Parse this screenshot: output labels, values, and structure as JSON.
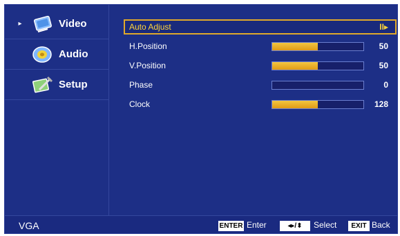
{
  "sidebar": {
    "items": [
      {
        "label": "Video",
        "icon": "video-icon",
        "selected": true
      },
      {
        "label": "Audio",
        "icon": "audio-icon",
        "selected": false
      },
      {
        "label": "Setup",
        "icon": "setup-icon",
        "selected": false
      }
    ],
    "arrow_glyph": "▸"
  },
  "main": {
    "rows": [
      {
        "label": "Auto Adjust",
        "selected": true,
        "action_glyph": "II▸"
      },
      {
        "label": "H.Position",
        "value": "50",
        "level": 0.5
      },
      {
        "label": "V.Position",
        "value": "50",
        "level": 0.5
      },
      {
        "label": "Phase",
        "value": "0",
        "level": 0
      },
      {
        "label": "Clock",
        "value": "128",
        "level": 0.5
      }
    ]
  },
  "footer": {
    "source": "VGA",
    "enter_key": "ENTER",
    "enter_label": "Enter",
    "nav_key": "◂▸/⬍",
    "nav_label": "Select",
    "exit_key": "EXIT",
    "exit_label": "Back"
  },
  "colors": {
    "background": "#1d2f86",
    "highlight_border": "#e1a92a",
    "highlight_text": "#ffd43a",
    "bar_fill": "#f2c640"
  }
}
